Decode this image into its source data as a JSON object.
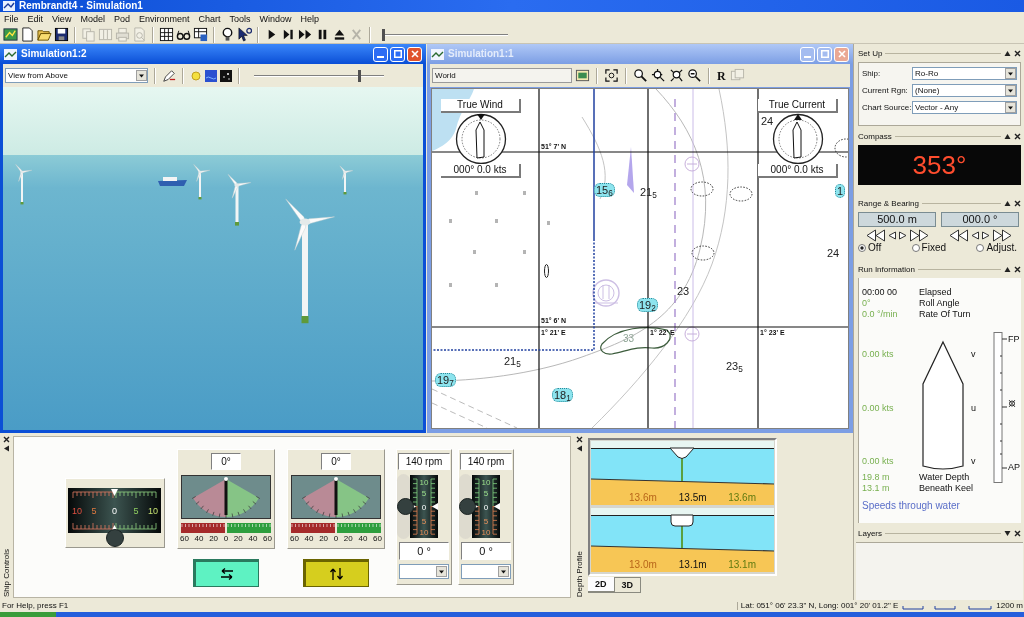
{
  "window": {
    "title": "Rembrandt4 - Simulation1"
  },
  "menu": [
    "File",
    "Edit",
    "View",
    "Model",
    "Pod",
    "Environment",
    "Chart",
    "Tools",
    "Window",
    "Help"
  ],
  "toolbar": {
    "groups": [
      [
        {
          "disabled": false
        },
        {
          "disabled": false
        },
        {
          "disabled": false
        },
        {
          "disabled": false
        }
      ],
      [
        {
          "disabled": true
        },
        {
          "disabled": true
        },
        {
          "disabled": true
        },
        {
          "disabled": true
        }
      ],
      [
        {
          "disabled": false
        },
        {
          "disabled": false
        },
        {
          "disabled": false
        }
      ],
      [
        {
          "disabled": false
        },
        {
          "disabled": false
        }
      ],
      [
        {
          "disabled": false
        },
        {
          "disabled": false
        },
        {
          "disabled": false
        },
        {
          "disabled": false
        },
        {
          "disabled": false
        },
        {
          "disabled": true
        }
      ]
    ],
    "slider": {
      "level": 0
    }
  },
  "view_window": {
    "title": "Simulation1:2",
    "active": true,
    "view": "View from Above",
    "slider": {
      "level": 0.82
    }
  },
  "chart_window": {
    "title": "Simulation1:1",
    "active": false,
    "layer": "World",
    "tools": [
      {
        "disabled": false
      },
      {
        "disabled": false
      },
      {
        "disabled": false
      },
      {
        "disabled": false
      },
      {
        "disabled": false
      },
      {
        "disabled": false
      },
      {
        "disabled": true
      }
    ],
    "tool_letter": "R",
    "dials": [
      {
        "kind": "wind",
        "title": "True Wind",
        "reading": "000° 0.0 kts"
      },
      {
        "kind": "current",
        "title": "True Current",
        "reading": "000° 0.0 kts"
      }
    ],
    "grid_labels": [
      "51° 7' N",
      "51° 6' N",
      "1° 21' E",
      "1° 22' E",
      "1° 23' E"
    ],
    "soundings": [
      {
        "text": "24",
        "kind": "plain"
      },
      {
        "text": "15$_{6}$",
        "kind": "marked"
      },
      {
        "text": "21$_{5}$",
        "kind": "plain"
      },
      {
        "text": "1",
        "kind": "marked"
      },
      {
        "text": "24",
        "kind": "plain"
      },
      {
        "text": "23",
        "kind": "plain"
      },
      {
        "text": "19$_{2}$",
        "kind": "marked"
      },
      {
        "text": "33",
        "kind": "faint"
      },
      {
        "text": "21$_{5}$",
        "kind": "plain"
      },
      {
        "text": "23$_{5}$",
        "kind": "plain"
      },
      {
        "text": "19$_{7}$",
        "kind": "marked"
      },
      {
        "text": "18$_{1}$",
        "kind": "marked"
      }
    ]
  },
  "setup": {
    "title": "Set Up",
    "expanded": true,
    "fields": [
      {
        "label": "Ship:",
        "value": "Ro-Ro"
      },
      {
        "label": "Current Rgn:",
        "value": "(None)"
      },
      {
        "label": "Chart Source:",
        "value": "Vector - Any"
      }
    ]
  },
  "compass": {
    "title": "Compass",
    "expanded": true,
    "heading": "353°"
  },
  "range_bearing": {
    "title": "Range & Bearing",
    "expanded": true,
    "range": "500.0 m",
    "bearing": "000.0 °",
    "modes": [
      {
        "label": "Off",
        "selected": true
      },
      {
        "label": "Fixed",
        "selected": false
      },
      {
        "label": "Adjust.",
        "selected": false
      }
    ]
  },
  "run_information": {
    "title": "Run Information",
    "expanded": true,
    "stats": [
      {
        "value": "00:00 00",
        "label": "Elapsed",
        "kind": "time"
      },
      {
        "value": "0°",
        "label": "Roll Angle",
        "kind": "measure"
      },
      {
        "value": "0.0 °/min",
        "label": "Rate Of Turn",
        "kind": "measure"
      }
    ],
    "speeds": [
      {
        "value": "0.00 kts",
        "axis": "v"
      },
      {
        "value": "0.00 kts",
        "axis": "u"
      },
      {
        "value": "0.00 kts",
        "axis": "v"
      }
    ],
    "hull_marks": [
      "FP",
      "AP"
    ],
    "depths": [
      {
        "value": "19.8 m",
        "label": "Water Depth"
      },
      {
        "value": "13.1 m",
        "label": "Beneath Keel"
      }
    ],
    "note": "Speeds through water"
  },
  "layers": {
    "title": "Layers",
    "expanded": false
  },
  "ship_controls": {
    "title": "Ship Controls",
    "thruster": {
      "level": 0.5,
      "scale": [
        "10",
        "5",
        "0",
        "5",
        "10"
      ]
    },
    "rudders": [
      {
        "angle": "0°",
        "scale": [
          "60",
          "40",
          "20",
          "0",
          "20",
          "40",
          "60"
        ],
        "mode_button": {
          "kind": "sideways"
        }
      },
      {
        "angle": "0°",
        "scale": [
          "60",
          "40",
          "20",
          "0",
          "20",
          "40",
          "60"
        ],
        "mode_button": {
          "kind": "updown"
        }
      }
    ],
    "engines": [
      {
        "rpm": "140 rpm",
        "angle": "0 °",
        "level": 0.5,
        "scale": [
          "10",
          "5",
          "0",
          "5",
          "10"
        ]
      },
      {
        "rpm": "140 rpm",
        "angle": "0 °",
        "level": 0.5,
        "scale": [
          "10",
          "5",
          "0",
          "5",
          "10"
        ]
      }
    ]
  },
  "depth_profile": {
    "title": "Depth Profile",
    "profiles": [
      {
        "kind": "v_hull",
        "readings": [
          "13.6m",
          "13.5m",
          "13.6m"
        ]
      },
      {
        "kind": "box_hull",
        "readings": [
          "13.0m",
          "13.1m",
          "13.1m"
        ]
      }
    ],
    "tabs": [
      {
        "label": "2D",
        "selected": true
      },
      {
        "label": "3D",
        "selected": false
      }
    ]
  },
  "status_bar": {
    "help": "For Help, press F1",
    "position": "Lat: 051° 06' 23.3\" N, Long: 001° 20' 01.2\" E",
    "scale": "1200 m"
  }
}
